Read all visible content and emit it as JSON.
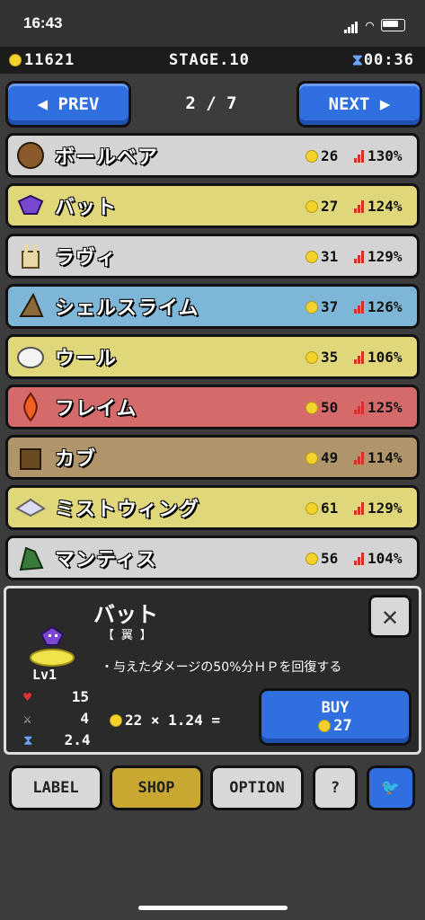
{
  "status_bar": {
    "time": "16:43"
  },
  "hud": {
    "coins": "11621",
    "stage": "STAGE.10",
    "timer": "00:36"
  },
  "nav": {
    "prev_label": "◀ PREV",
    "next_label": "NEXT ▶",
    "page": "2 / 7"
  },
  "monsters": [
    {
      "name": "ボールベア",
      "price": "26",
      "stat": "130%",
      "color": "#d4d4d4",
      "icon": "ball-bear-icon"
    },
    {
      "name": "バット",
      "price": "27",
      "stat": "124%",
      "color": "#e0d77a",
      "icon": "bat-icon"
    },
    {
      "name": "ラヴィ",
      "price": "31",
      "stat": "129%",
      "color": "#d4d4d4",
      "icon": "rabbit-icon"
    },
    {
      "name": "シェルスライム",
      "price": "37",
      "stat": "126%",
      "color": "#7eb6d8",
      "icon": "shell-slime-icon"
    },
    {
      "name": "ウール",
      "price": "35",
      "stat": "106%",
      "color": "#e0d77a",
      "icon": "sheep-icon"
    },
    {
      "name": "フレイム",
      "price": "50",
      "stat": "125%",
      "color": "#d46a6a",
      "icon": "flame-icon"
    },
    {
      "name": "カブ",
      "price": "49",
      "stat": "114%",
      "color": "#b0946a",
      "icon": "stump-icon"
    },
    {
      "name": "ミストウィング",
      "price": "61",
      "stat": "129%",
      "color": "#e0d77a",
      "icon": "mist-wing-icon"
    },
    {
      "name": "マンティス",
      "price": "56",
      "stat": "104%",
      "color": "#d4d4d4",
      "icon": "mantis-icon"
    }
  ],
  "detail": {
    "name": "バット",
    "type": "【 翼 】",
    "level": "Lv1",
    "description": "・与えたダメージの50%分ＨＰを回復する",
    "hp": "15",
    "attack": "4",
    "speed": "2.4",
    "calc": "22 × 1.24 =",
    "buy_label": "BUY",
    "buy_price": "27"
  },
  "bottom": {
    "label": "LABEL",
    "shop": "SHOP",
    "option": "OPTION",
    "help": "?"
  }
}
